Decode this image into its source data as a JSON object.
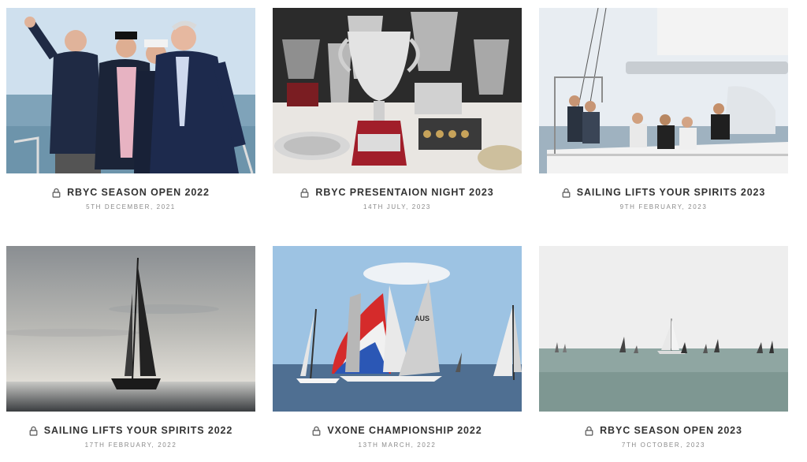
{
  "gallery": {
    "albums": [
      {
        "title": "RBYC SEASON OPEN 2022",
        "date": "5TH DECEMBER, 2021",
        "icon": "lock-icon"
      },
      {
        "title": "RBYC PRESENTAION NIGHT 2023",
        "date": "14TH JULY, 2023",
        "icon": "lock-icon"
      },
      {
        "title": "SAILING LIFTS YOUR SPIRITS 2023",
        "date": "9TH FEBRUARY, 2023",
        "icon": "lock-icon"
      },
      {
        "title": "SAILING LIFTS YOUR SPIRITS 2022",
        "date": "17TH FEBRUARY, 2022",
        "icon": "lock-icon"
      },
      {
        "title": "VXONE CHAMPIONSHIP 2022",
        "date": "13TH MARCH, 2022",
        "icon": "lock-icon"
      },
      {
        "title": "RBYC SEASON OPEN 2023",
        "date": "7TH OCTOBER, 2023",
        "icon": "lock-icon"
      }
    ]
  },
  "colors": {
    "title": "#333333",
    "date": "#8a8a8a",
    "background": "#ffffff"
  }
}
